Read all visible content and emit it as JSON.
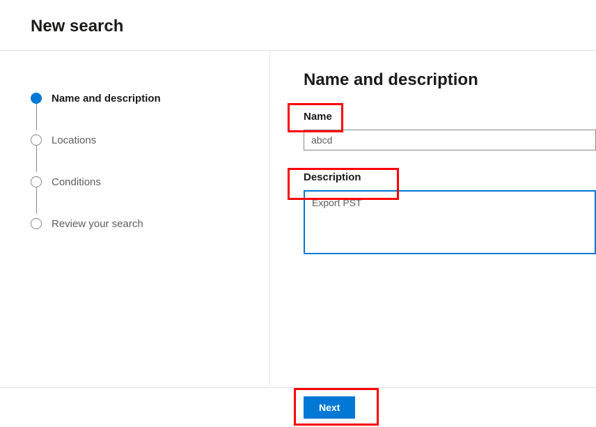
{
  "page_title": "New search",
  "sidebar": {
    "steps": [
      {
        "label": "Name and description",
        "active": true
      },
      {
        "label": "Locations",
        "active": false
      },
      {
        "label": "Conditions",
        "active": false
      },
      {
        "label": "Review your search",
        "active": false
      }
    ]
  },
  "main": {
    "heading": "Name and description",
    "name_label": "Name",
    "name_value": "abcd",
    "description_label": "Description",
    "description_value": "Export PST"
  },
  "footer": {
    "next_label": "Next"
  },
  "highlights": {
    "name": true,
    "description": true,
    "next": true
  }
}
